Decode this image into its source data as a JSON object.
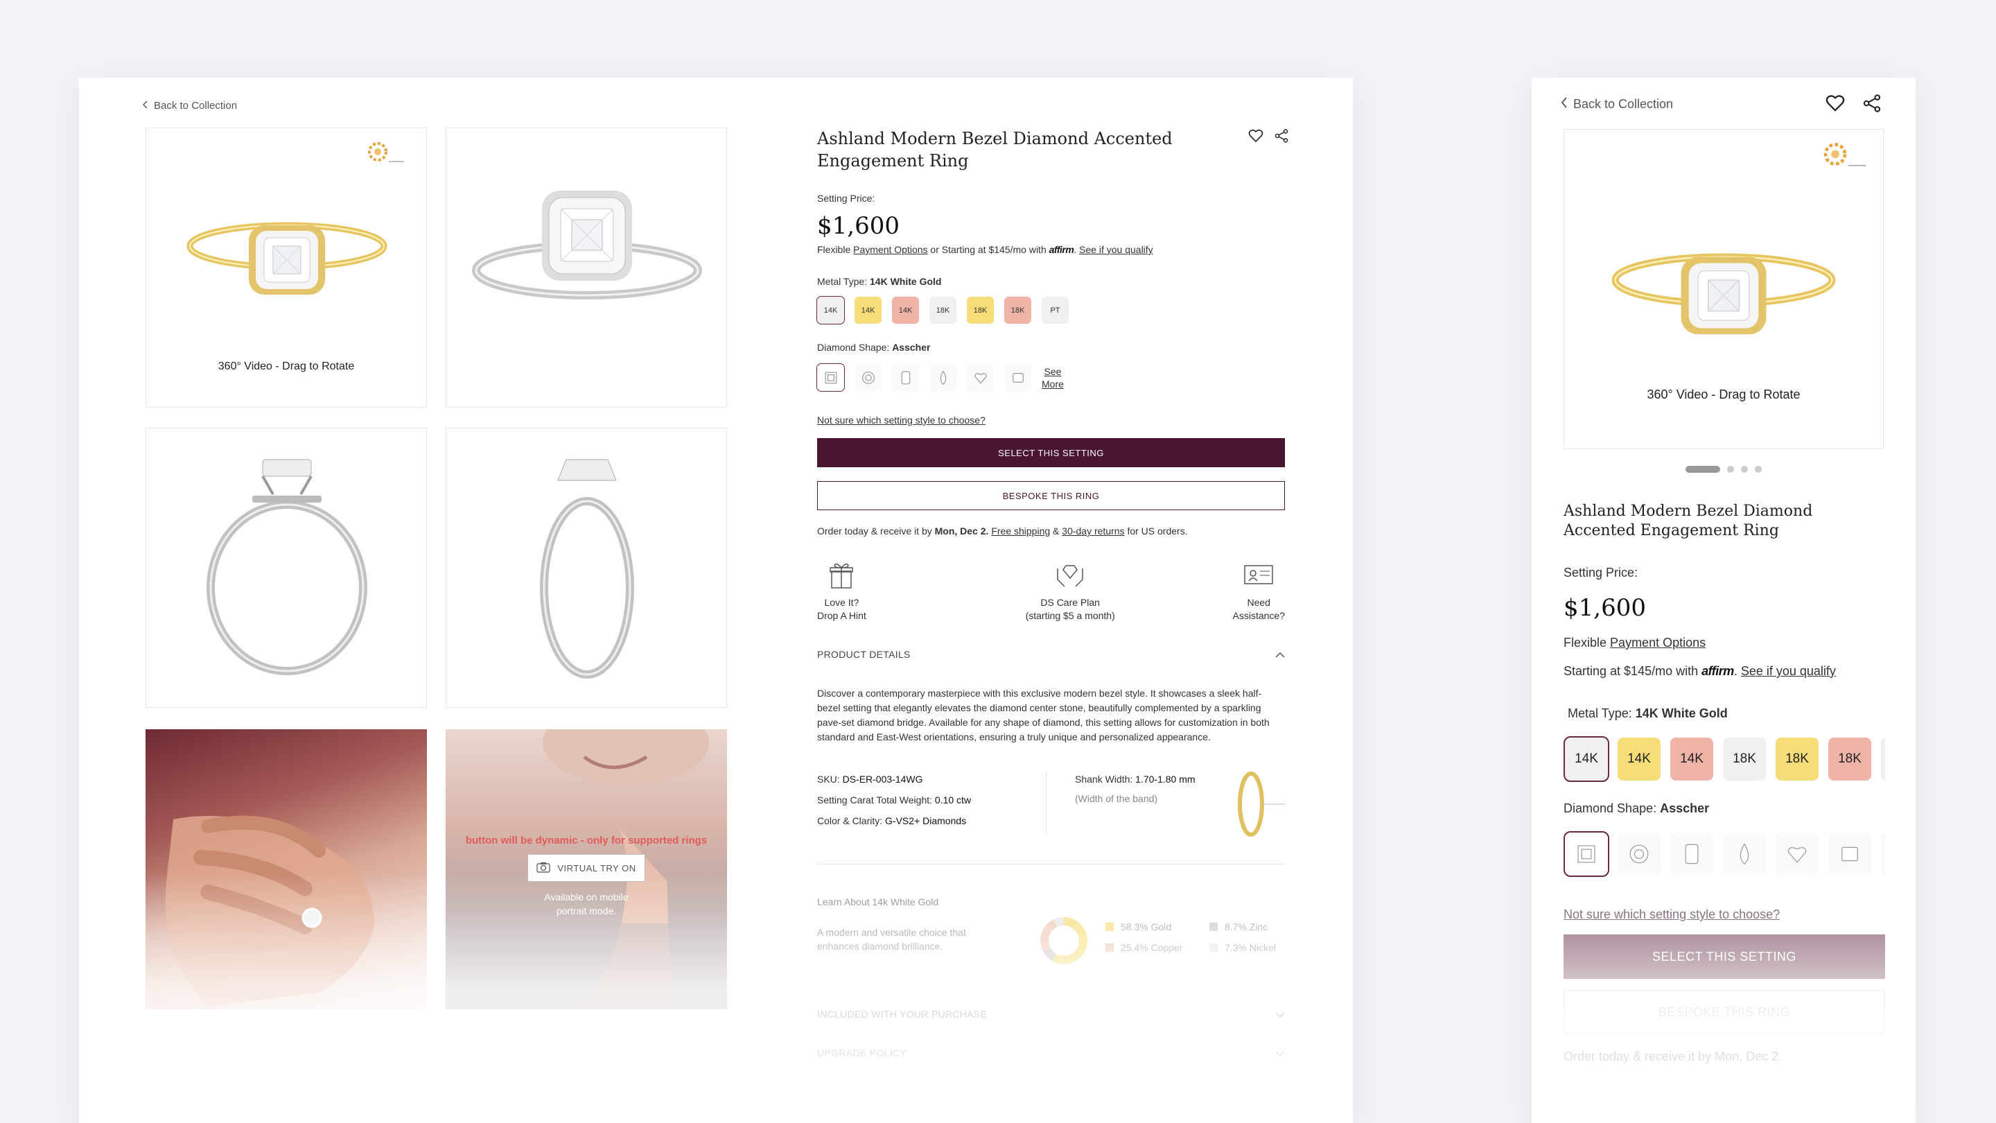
{
  "desktop": {
    "back_label": "Back to Collection",
    "video_caption": "360° Video - Drag to Rotate",
    "vto": {
      "red_note": "button will be dynamic - only for supported rings",
      "button_label": "VIRTUAL TRY ON",
      "mobile_note_1": "Available on mobile",
      "mobile_note_2": "portrait mode."
    },
    "title": "Ashland Modern Bezel Diamond Accented Engagement Ring",
    "setting_price_label": "Setting Price:",
    "price": "$1,600",
    "flex_prefix": "Flexible",
    "payment_options": "Payment Options",
    "starting_text": "or Starting at $145/mo with",
    "affirm": "affirm",
    "qualify": "See if you qualify",
    "metal_label": "Metal Type:",
    "metal_value": "14K White Gold",
    "metals": [
      {
        "label": "14K",
        "color": "#f0f0f0"
      },
      {
        "label": "14K",
        "color": "#f7dd7a"
      },
      {
        "label": "14K",
        "color": "#efb3a8"
      },
      {
        "label": "18K",
        "color": "#f0f0f0"
      },
      {
        "label": "18K",
        "color": "#f7dd7a"
      },
      {
        "label": "18K",
        "color": "#efb3a8"
      },
      {
        "label": "PT",
        "color": "#f0f0f0"
      }
    ],
    "shape_label": "Diamond Shape:",
    "shape_value": "Asscher",
    "see_more_1": "See",
    "see_more_2": "More",
    "not_sure": "Not sure which setting style to choose?",
    "select_btn": "SELECT THIS SETTING",
    "bespoke_btn": "BESPOKE THIS RING",
    "order_prefix": "Order today & receive it by",
    "order_date": "Mon, Dec 2.",
    "free_shipping": "Free shipping",
    "amp": "&",
    "returns": "30-day returns",
    "order_suffix": "for US orders.",
    "perks": [
      {
        "line1": "Love It?",
        "line2": "Drop A Hint"
      },
      {
        "line1": "DS Care Plan",
        "line2": "(starting $5 a month)"
      },
      {
        "line1": "Need",
        "line2": "Assistance?"
      }
    ],
    "product_details_label": "PRODUCT DETAILS",
    "description": "Discover a contemporary masterpiece with this exclusive modern bezel style. It showcases a sleek half-bezel setting that elegantly elevates the diamond center stone, beautifully complemented by a sparkling pave-set diamond bridge. Available for any shape of diamond, this setting allows for customization in both standard and East-West orientations, ensuring a truly unique and personalized appearance.",
    "sku_label": "SKU:",
    "sku": "DS-ER-003-14WG",
    "carat_label": "Setting Carat Total Weight:",
    "carat": "0.10 ctw",
    "clarity_label": "Color & Clarity:",
    "clarity": "G-VS2+ Diamonds",
    "shank_label": "Shank Width:",
    "shank": "1.70-1.80 mm",
    "shank_note": "(Width of the band)",
    "learn_label": "Learn About 14k White Gold",
    "learn_desc_1": "A modern and versatile choice that",
    "learn_desc_2": "enhances diamond brilliance.",
    "composition": [
      {
        "label": "58.3% Gold",
        "value": 58.3,
        "color": "#f7dd7a"
      },
      {
        "label": "8.7% Zinc",
        "value": 8.7,
        "color": "#c9c9c9"
      },
      {
        "label": "25.4% Copper",
        "value": 25.4,
        "color": "#efc8b3"
      },
      {
        "label": "7.3% Nickel",
        "value": 7.3,
        "color": "#e6e6e6"
      }
    ],
    "included_label": "INCLUDED WITH YOUR PURCHASE",
    "upgrade_label": "UPGRADE POLICY"
  },
  "mobile": {
    "back_label": "Back to Collection",
    "video_caption": "360° Video - Drag to Rotate",
    "title": "Ashland Modern Bezel Diamond Accented Engagement Ring",
    "setting_price_label": "Setting Price:",
    "price": "$1,600",
    "flex_prefix": "Flexible",
    "payment_options": "Payment Options",
    "starting_text": "Starting at $145/mo with",
    "affirm": "affirm",
    "qualify": "See if you qualify",
    "metal_label": "Metal Type:",
    "metal_value": "14K White Gold",
    "metals": [
      {
        "label": "14K",
        "color": "#f0f0f0"
      },
      {
        "label": "14K",
        "color": "#f7dd7a"
      },
      {
        "label": "14K",
        "color": "#efb3a8"
      },
      {
        "label": "18K",
        "color": "#f0f0f0"
      },
      {
        "label": "18K",
        "color": "#f7dd7a"
      },
      {
        "label": "18K",
        "color": "#efb3a8"
      }
    ],
    "shape_label": "Diamond Shape:",
    "shape_value": "Asscher",
    "not_sure": "Not sure which setting style to choose?",
    "select_btn": "SELECT THIS SETTING",
    "bespoke_btn": "BESPOKE THIS RING",
    "order_prefix": "Order today & receive it by",
    "order_date": "Mon, Dec 2."
  }
}
